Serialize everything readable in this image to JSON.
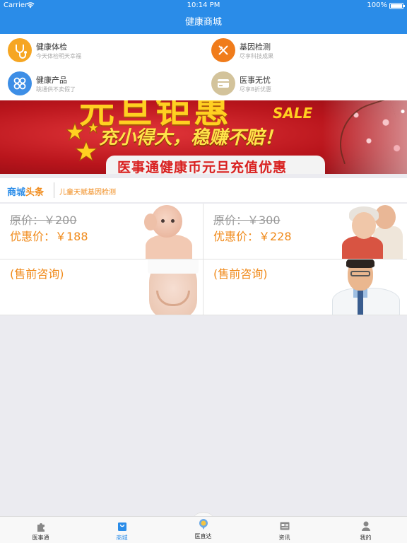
{
  "status_bar": {
    "carrier": "Carrier",
    "time": "10:14 PM",
    "battery": "100%"
  },
  "nav": {
    "title": "健康商城"
  },
  "menu": [
    {
      "title": "健康体检",
      "subtitle": "今天体检明天幸福",
      "icon": "stethoscope-icon",
      "color": "#f6a623"
    },
    {
      "title": "基因检测",
      "subtitle": "尽享科技成果",
      "icon": "dna-icon",
      "color": "#f07c1b"
    },
    {
      "title": "健康产品",
      "subtitle": "跳通供不卖假了",
      "icon": "grid-icon",
      "color": "#3d8ee6"
    },
    {
      "title": "医事无忧",
      "subtitle": "尽享8折优惠",
      "icon": "card-icon",
      "color": "#d3c39b"
    }
  ],
  "banner": {
    "headline_top": "元旦钜惠",
    "sale": "SALE",
    "main_text": "充小得大，稳赚不赔！",
    "bottom_text": "医事通健康币元旦充值优惠"
  },
  "headline": {
    "brand_part1": "商城",
    "brand_part2": "头条",
    "news": "儿童天赋基因检测"
  },
  "products": [
    {
      "original_price": "原价：￥200",
      "deal_price": "优惠价：￥188",
      "image": "baby-photo"
    },
    {
      "original_price": "原价：￥300",
      "deal_price": "优惠价：￥228",
      "image": "seniors-photo"
    },
    {
      "consult": "(售前咨询)",
      "image": "belly-photo"
    },
    {
      "consult": "(售前咨询)",
      "image": "doctor-photo"
    }
  ],
  "tabs": [
    {
      "label": "医事通",
      "icon": "puzzle-icon",
      "active": false
    },
    {
      "label": "商城",
      "icon": "shopping-bag-icon",
      "active": true
    },
    {
      "label": "医直达",
      "icon": "location-pin-icon",
      "active": false
    },
    {
      "label": "资讯",
      "icon": "news-icon",
      "active": false
    },
    {
      "label": "我的",
      "icon": "user-icon",
      "active": false
    }
  ],
  "colors": {
    "primary": "#2a8ce8",
    "accent": "#f08a1a",
    "background": "#ebebf0"
  }
}
